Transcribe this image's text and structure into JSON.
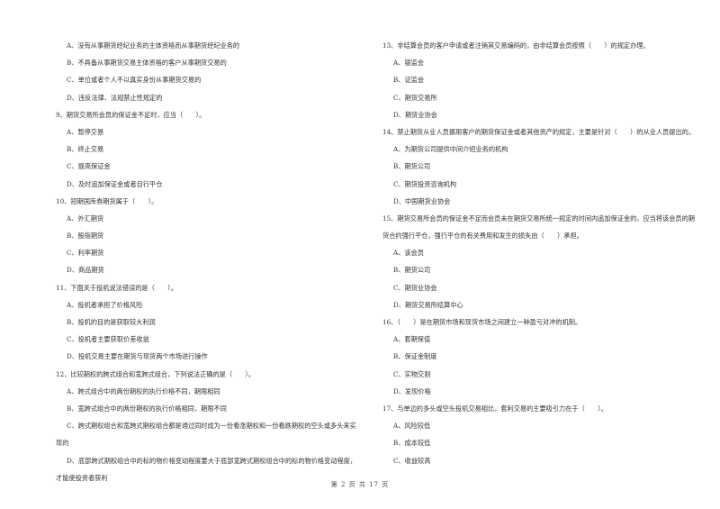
{
  "left_column": {
    "q8_options": [
      "A、没有从事期货经纪业务的主体资格而从事期货经纪业务的",
      "B、不具备从事期货交易主体资格的客户从事期货交易的",
      "C、单位或者个人不以真实身份从事期货交易的",
      "D、违反法律、法规禁止性规定的"
    ],
    "q9": {
      "stem": "9、期货交易所会员的保证金不足时，应当（　　）。",
      "options": [
        "A、暂停交易",
        "B、终止交易",
        "C、提高保证金",
        "D、及时追加保证金或者自行平仓"
      ]
    },
    "q10": {
      "stem": "10、短期国库券期货属于（　　）。",
      "options": [
        "A、外汇期货",
        "B、股指期货",
        "C、利率期货",
        "D、商品期货"
      ]
    },
    "q11": {
      "stem": "11、下面关于投机说法错误的是（　　）。",
      "options": [
        "A、投机者承担了价格风险",
        "B、投机的目的是获取较大利润",
        "C、投机者主要获取价差收益",
        "D、投机交易主要在期货与现货两个市场进行操作"
      ]
    },
    "q12": {
      "stem": "12、比较期权的跨式组合和宽跨式组合，下列说法正确的是（　　）。",
      "options": [
        "A、跨式组合中的两份期权的执行价格不同，期限相同",
        "B、宽跨式组合中的两份期权的执行价格相同，期限不同",
        "C、跨式期权组合和宽跨式期权组合都是通过同时成为一份看涨期权和一份看跌期权的空头或多头来实现的",
        "D、底部跨式期权组合中的标的物价格变动程度要大于底部宽跨式期权组合中的标的物价格变动程度，才能使投资者获利"
      ]
    }
  },
  "right_column": {
    "q13": {
      "stem": "13、非结算会员的客户申请或者注销其交易编码的，由非结算会员按照（　　）的规定办理。",
      "options": [
        "A、银监会",
        "B、证监会",
        "C、期货交易所",
        "D、期货业协会"
      ]
    },
    "q14": {
      "stem": "14、禁止期货从业人员挪用客户的期货保证金或者其他资产的规定，主要是针对（　　）的从业人员提出的。",
      "options": [
        "A、为期货公司提供中间介绍业务的机构",
        "B、期货公司",
        "C、期货投资咨询机构",
        "D、中国期货业协会"
      ]
    },
    "q15": {
      "stem": "15、期货交易所会员的保证金不足而会员未在期货交易所统一规定的时间内追加保证金的，应当将该会员的期货合约强行平仓，强行平仓的有关费用和发生的损失由（　　）承担。",
      "options": [
        "A、该会员",
        "B、期货公司",
        "C、期货业协会",
        "D、期货交易所结算中心"
      ]
    },
    "q16": {
      "stem": "16、（　　）是在期货市场和现货市场之间建立一种盈亏对冲的机制。",
      "options": [
        "A、套期保值",
        "B、保证金制度",
        "C、实物交割",
        "D、发现价格"
      ]
    },
    "q17": {
      "stem": "17、与单边的多头或空头投机交易相比，套利交易的主要吸引力在于（　　）。",
      "options": [
        "A、风险较低",
        "B、成本较低",
        "C、收益较高"
      ]
    }
  },
  "footer": {
    "page_label": "第 2 页 共 17 页"
  }
}
